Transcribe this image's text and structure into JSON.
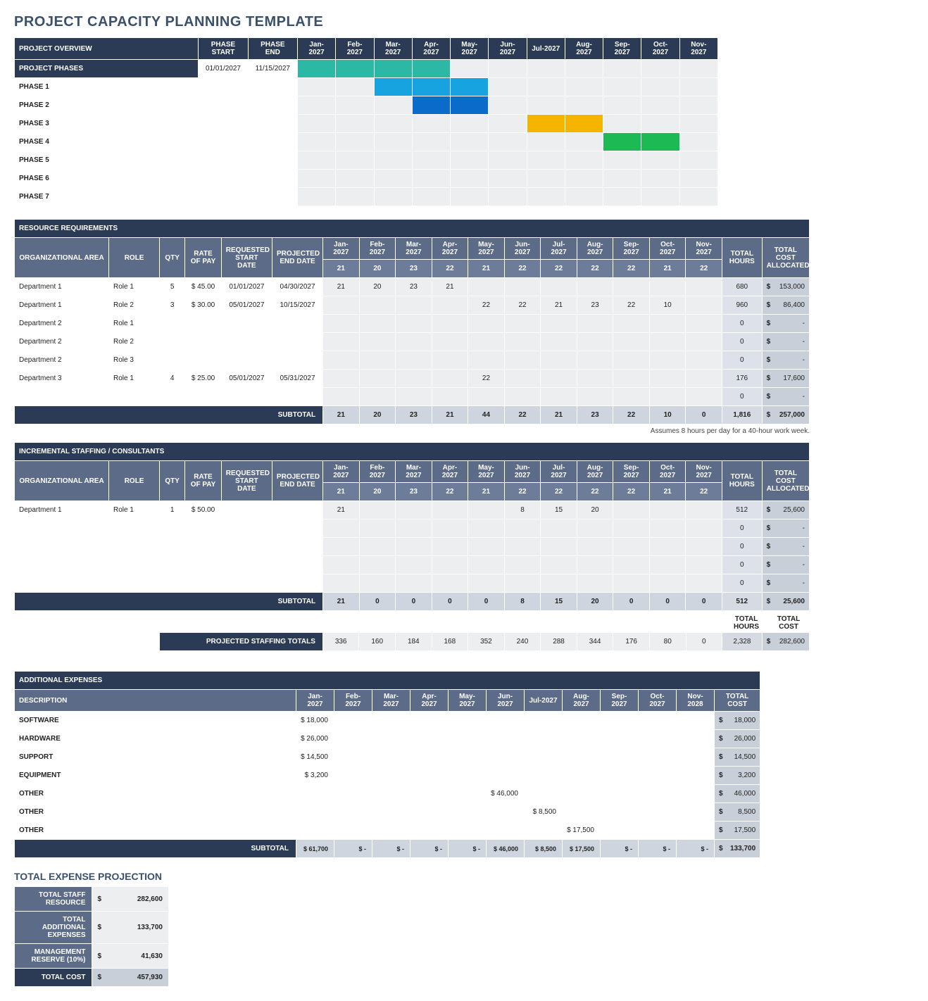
{
  "title": "PROJECT CAPACITY PLANNING TEMPLATE",
  "months": [
    "Jan-2027",
    "Feb-2027",
    "Mar-2027",
    "Apr-2027",
    "May-2027",
    "Jun-2027",
    "Jul-2027",
    "Aug-2027",
    "Sep-2027",
    "Oct-2027",
    "Nov-2027"
  ],
  "overview": {
    "headers": {
      "overview": "PROJECT OVERVIEW",
      "phaseStart": "PHASE START",
      "phaseEnd": "PHASE END"
    },
    "phasesHeader": "PROJECT PHASES",
    "phaseStartVal": "01/01/2027",
    "phaseEndVal": "11/15/2027",
    "phases": [
      {
        "label": "PROJECT PHASES",
        "isHeader": true
      },
      {
        "label": "PHASE 1",
        "bar": {
          "color": "#17a2e0",
          "start": 2,
          "span": 3
        }
      },
      {
        "label": "PHASE 2",
        "bar": {
          "color": "#0b6bcb",
          "start": 3,
          "span": 2
        }
      },
      {
        "label": "PHASE 3",
        "bar": {
          "color": "#f4b400",
          "start": 6,
          "span": 2
        }
      },
      {
        "label": "PHASE 4",
        "bar": {
          "color": "#1db954",
          "start": 8,
          "span": 2
        }
      },
      {
        "label": "PHASE 5"
      },
      {
        "label": "PHASE 6"
      },
      {
        "label": "PHASE 7"
      }
    ],
    "topBar": {
      "color": "#2bb9a6",
      "start": 0,
      "span": 4
    }
  },
  "footnote": "Assumes 8 hours per day for a 40-hour work week.",
  "resource": {
    "title": "RESOURCE REQUIREMENTS",
    "headers": {
      "org": "ORGANIZATIONAL AREA",
      "role": "ROLE",
      "qty": "QTY",
      "rate": "RATE OF PAY",
      "reqStart": "REQUESTED START DATE",
      "projEnd": "PROJECTED END DATE",
      "totHours": "TOTAL HOURS",
      "totCost": "TOTAL COST ALLOCATED"
    },
    "monthSub": [
      "21",
      "20",
      "23",
      "22",
      "21",
      "22",
      "22",
      "22",
      "22",
      "21",
      "22"
    ],
    "rows": [
      {
        "org": "Department 1",
        "role": "Role 1",
        "qty": "5",
        "rate": "$ 45.00",
        "reqStart": "01/01/2027",
        "projEnd": "04/30/2027",
        "m": [
          "21",
          "20",
          "23",
          "21",
          "",
          "",
          "",
          "",
          "",
          "",
          ""
        ],
        "hours": "680",
        "cost": "153,000"
      },
      {
        "org": "Department 1",
        "role": "Role 2",
        "qty": "3",
        "rate": "$ 30.00",
        "reqStart": "05/01/2027",
        "projEnd": "10/15/2027",
        "m": [
          "",
          "",
          "",
          "",
          "22",
          "22",
          "21",
          "23",
          "22",
          "10",
          ""
        ],
        "hours": "960",
        "cost": "86,400"
      },
      {
        "org": "Department 2",
        "role": "Role 1",
        "qty": "",
        "rate": "",
        "reqStart": "",
        "projEnd": "",
        "m": [
          "",
          "",
          "",
          "",
          "",
          "",
          "",
          "",
          "",
          "",
          ""
        ],
        "hours": "0",
        "cost": "-"
      },
      {
        "org": "Department 2",
        "role": "Role 2",
        "qty": "",
        "rate": "",
        "reqStart": "",
        "projEnd": "",
        "m": [
          "",
          "",
          "",
          "",
          "",
          "",
          "",
          "",
          "",
          "",
          ""
        ],
        "hours": "0",
        "cost": "-"
      },
      {
        "org": "Department 2",
        "role": "Role 3",
        "qty": "",
        "rate": "",
        "reqStart": "",
        "projEnd": "",
        "m": [
          "",
          "",
          "",
          "",
          "",
          "",
          "",
          "",
          "",
          "",
          ""
        ],
        "hours": "0",
        "cost": "-"
      },
      {
        "org": "Department 3",
        "role": "Role 1",
        "qty": "4",
        "rate": "$ 25.00",
        "reqStart": "05/01/2027",
        "projEnd": "05/31/2027",
        "m": [
          "",
          "",
          "",
          "",
          "22",
          "",
          "",
          "",
          "",
          "",
          ""
        ],
        "hours": "176",
        "cost": "17,600"
      },
      {
        "org": "",
        "role": "",
        "qty": "",
        "rate": "",
        "reqStart": "",
        "projEnd": "",
        "m": [
          "",
          "",
          "",
          "",
          "",
          "",
          "",
          "",
          "",
          "",
          ""
        ],
        "hours": "0",
        "cost": "-"
      }
    ],
    "subtotalLabel": "SUBTOTAL",
    "subtotals": {
      "m": [
        "21",
        "20",
        "23",
        "21",
        "44",
        "22",
        "21",
        "23",
        "22",
        "10",
        "0"
      ],
      "hours": "1,816",
      "cost": "257,000"
    }
  },
  "incremental": {
    "title": "INCREMENTAL STAFFING / CONSULTANTS",
    "monthSub": [
      "21",
      "20",
      "23",
      "22",
      "21",
      "22",
      "22",
      "22",
      "22",
      "21",
      "22"
    ],
    "rows": [
      {
        "org": "Department 1",
        "role": "Role 1",
        "qty": "1",
        "rate": "$ 50.00",
        "reqStart": "",
        "projEnd": "",
        "m": [
          "21",
          "",
          "",
          "",
          "",
          "8",
          "15",
          "20",
          "",
          "",
          ""
        ],
        "hours": "512",
        "cost": "25,600"
      },
      {
        "org": "",
        "role": "",
        "qty": "",
        "rate": "",
        "reqStart": "",
        "projEnd": "",
        "m": [
          "",
          "",
          "",
          "",
          "",
          "",
          "",
          "",
          "",
          "",
          ""
        ],
        "hours": "0",
        "cost": "-"
      },
      {
        "org": "",
        "role": "",
        "qty": "",
        "rate": "",
        "reqStart": "",
        "projEnd": "",
        "m": [
          "",
          "",
          "",
          "",
          "",
          "",
          "",
          "",
          "",
          "",
          ""
        ],
        "hours": "0",
        "cost": "-"
      },
      {
        "org": "",
        "role": "",
        "qty": "",
        "rate": "",
        "reqStart": "",
        "projEnd": "",
        "m": [
          "",
          "",
          "",
          "",
          "",
          "",
          "",
          "",
          "",
          "",
          ""
        ],
        "hours": "0",
        "cost": "-"
      },
      {
        "org": "",
        "role": "",
        "qty": "",
        "rate": "",
        "reqStart": "",
        "projEnd": "",
        "m": [
          "",
          "",
          "",
          "",
          "",
          "",
          "",
          "",
          "",
          "",
          ""
        ],
        "hours": "0",
        "cost": "-"
      }
    ],
    "subtotalLabel": "SUBTOTAL",
    "subtotals": {
      "m": [
        "21",
        "0",
        "0",
        "0",
        "0",
        "8",
        "15",
        "20",
        "0",
        "0",
        "0"
      ],
      "hours": "512",
      "cost": "25,600"
    }
  },
  "miniLabels": {
    "hours": "TOTAL HOURS",
    "cost": "TOTAL COST"
  },
  "projStaff": {
    "label": "PROJECTED STAFFING TOTALS",
    "m": [
      "336",
      "160",
      "184",
      "168",
      "352",
      "240",
      "288",
      "344",
      "176",
      "80",
      "0"
    ],
    "hours": "2,328",
    "cost": "282,600"
  },
  "expenses": {
    "title": "ADDITIONAL EXPENSES",
    "descHeader": "DESCRIPTION",
    "months": [
      "Jan-2027",
      "Feb-2027",
      "Mar-2027",
      "Apr-2027",
      "May-2027",
      "Jun-2027",
      "Jul-2027",
      "Aug-2027",
      "Sep-2027",
      "Oct-2027",
      "Nov-2028"
    ],
    "totalCostHeader": "TOTAL COST",
    "rows": [
      {
        "desc": "SOFTWARE",
        "m": [
          "$ 18,000",
          "",
          "",
          "",
          "",
          "",
          "",
          "",
          "",
          "",
          ""
        ],
        "total": "18,000"
      },
      {
        "desc": "HARDWARE",
        "m": [
          "$ 26,000",
          "",
          "",
          "",
          "",
          "",
          "",
          "",
          "",
          "",
          ""
        ],
        "total": "26,000"
      },
      {
        "desc": "SUPPORT",
        "m": [
          "$ 14,500",
          "",
          "",
          "",
          "",
          "",
          "",
          "",
          "",
          "",
          ""
        ],
        "total": "14,500"
      },
      {
        "desc": "EQUIPMENT",
        "m": [
          "$   3,200",
          "",
          "",
          "",
          "",
          "",
          "",
          "",
          "",
          "",
          ""
        ],
        "total": "3,200"
      },
      {
        "desc": "OTHER",
        "m": [
          "",
          "",
          "",
          "",
          "",
          "$ 46,000",
          "",
          "",
          "",
          "",
          ""
        ],
        "total": "46,000"
      },
      {
        "desc": "OTHER",
        "m": [
          "",
          "",
          "",
          "",
          "",
          "",
          "$  8,500",
          "",
          "",
          "",
          ""
        ],
        "total": "8,500"
      },
      {
        "desc": "OTHER",
        "m": [
          "",
          "",
          "",
          "",
          "",
          "",
          "",
          "$ 17,500",
          "",
          "",
          ""
        ],
        "total": "17,500"
      }
    ],
    "subtotalLabel": "SUBTOTAL",
    "subtotals": {
      "m": [
        "$ 61,700",
        "$      -",
        "$      -",
        "$      -",
        "$      -",
        "$ 46,000",
        "$  8,500",
        "$ 17,500",
        "$      -",
        "$      -",
        "$      -"
      ],
      "total": "133,700"
    }
  },
  "totalExpense": {
    "title": "TOTAL EXPENSE PROJECTION",
    "rows": [
      {
        "label": "TOTAL STAFF RESOURCE",
        "val": "282,600",
        "dark": false
      },
      {
        "label": "TOTAL ADDITIONAL EXPENSES",
        "val": "133,700",
        "dark": false
      },
      {
        "label": "MANAGEMENT RESERVE (10%)",
        "val": "41,630",
        "dark": false
      },
      {
        "label": "TOTAL COST",
        "val": "457,930",
        "dark": true
      }
    ]
  }
}
